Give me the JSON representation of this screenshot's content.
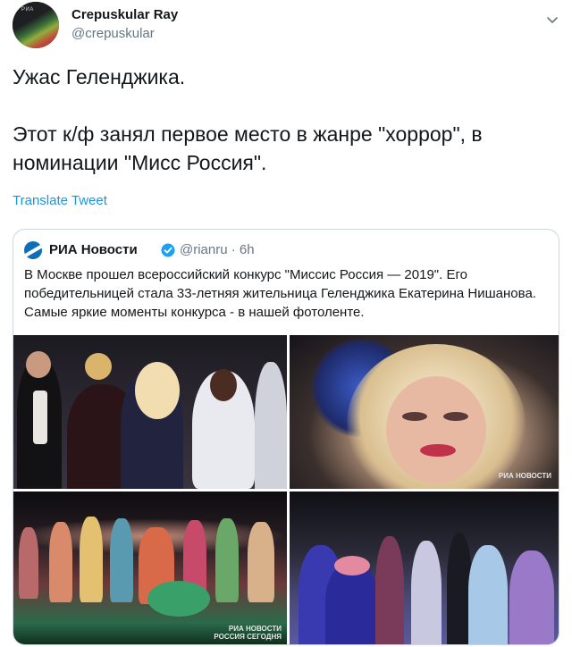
{
  "author": {
    "display_name": "Crepuskular Ray",
    "handle": "@crepuskular",
    "avatar_tag": "РИА"
  },
  "tweet": {
    "line1": "Ужас Геленджика.",
    "line2": "Этот к/ф занял первое место в жанре \"хоррор\", в номинации \"Мисс Россия\"."
  },
  "translate_label": "Translate Tweet",
  "quoted": {
    "name": "РИА Новости",
    "handle": "@rianru",
    "separator": "·",
    "time": "6h",
    "text": "В Москве прошел всероссийский конкурс \"Миссис Россия — 2019\". Его победительницей стала 33-летняя жительница Геленджика Екатерина Нишанова. Самые яркие моменты конкурса - в нашей фотоленте.",
    "photo_watermark_top": "РИА НОВОСТИ",
    "photo_watermark_bottom": "РИА НОВОСТИ",
    "photo_watermark_bottom2": "РОССИЯ СЕГОДНЯ"
  },
  "colors": {
    "link": "#1b95e0",
    "verified": "#1da1f2",
    "secondary_text": "#657786"
  }
}
